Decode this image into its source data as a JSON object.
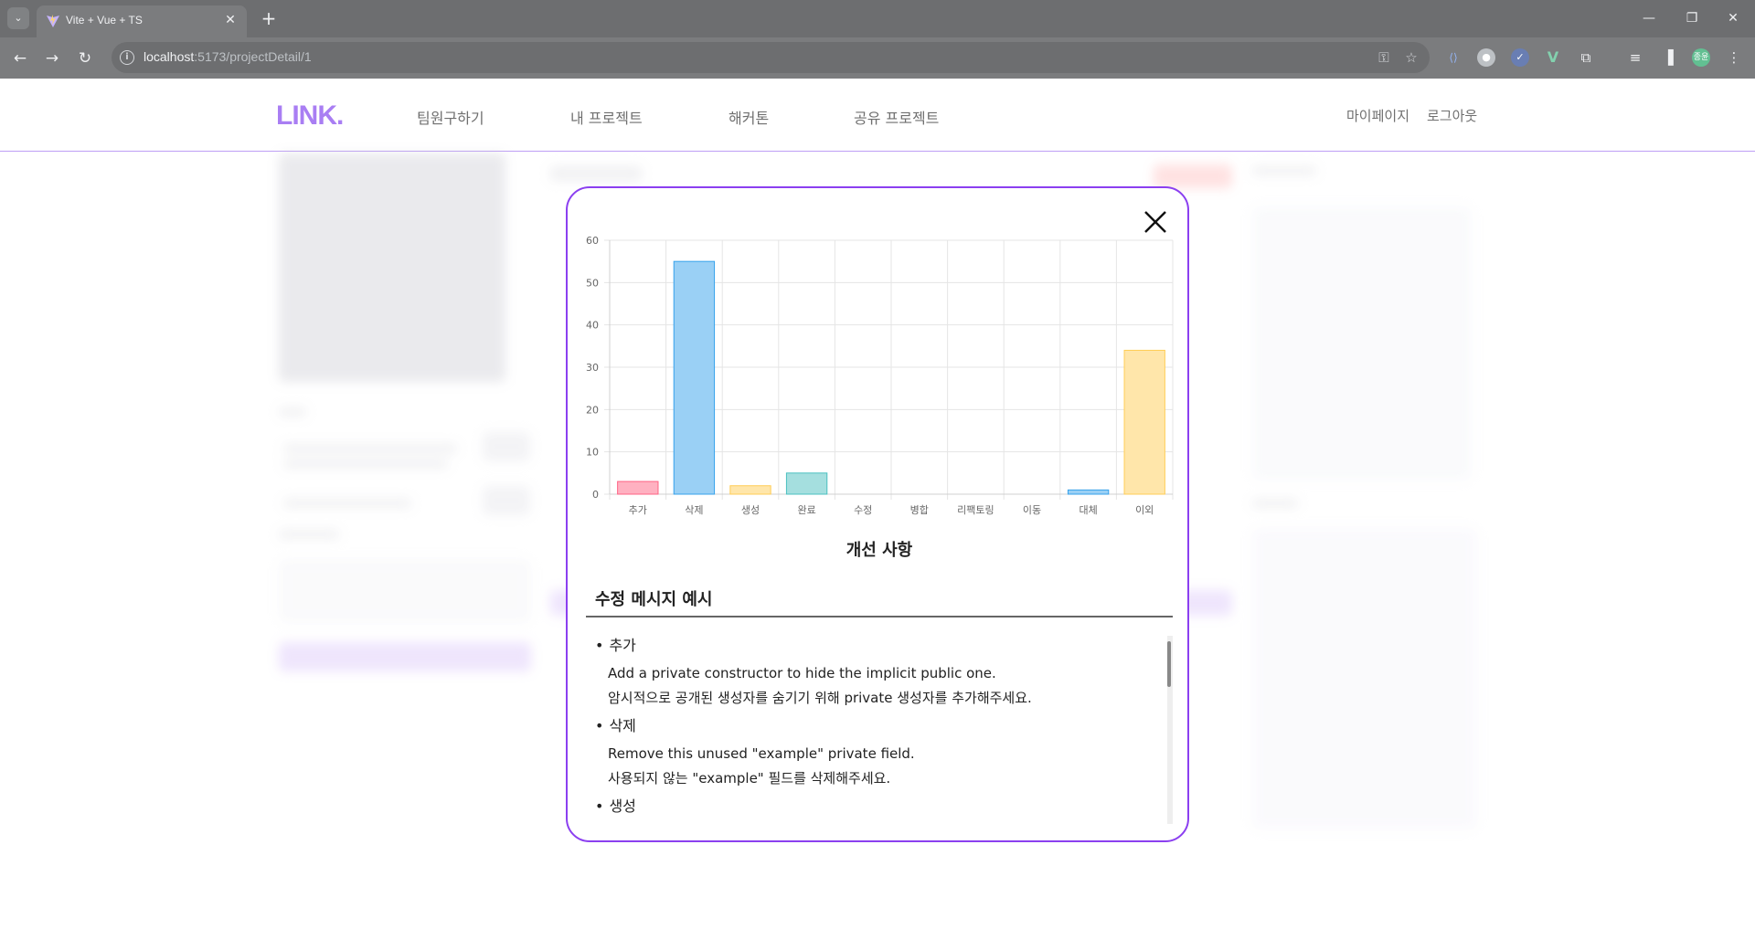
{
  "browser": {
    "tab_title": "Vite + Vue + TS",
    "url_host": "localhost",
    "url_rest": ":5173/projectDetail/1",
    "profile_initials": "종윤"
  },
  "site": {
    "logo": "LINK.",
    "nav": [
      "팀원구하기",
      "내 프로젝트",
      "해커톤",
      "공유 프로젝트"
    ],
    "mypage": "마이페이지",
    "logout": "로그아웃"
  },
  "modal": {
    "chart_title": "개선 사항",
    "section_title": "수정 메시지 예시",
    "messages": [
      {
        "category": "추가",
        "lines": [
          "Add a private constructor to hide the implicit public one.",
          "암시적으로 공개된 생성자를 숨기기 위해 private 생성자를 추가해주세요."
        ]
      },
      {
        "category": "삭제",
        "lines": [
          "Remove this unused \"example\" private field.",
          "사용되지 않는 \"example\" 필드를 삭제해주세요."
        ]
      },
      {
        "category": "생성",
        "lines": []
      }
    ]
  },
  "chart_data": {
    "type": "bar",
    "title": "개선 사항",
    "categories": [
      "추가",
      "삭제",
      "생성",
      "완료",
      "수정",
      "병합",
      "리팩토링",
      "이동",
      "대체",
      "이외"
    ],
    "values": [
      3,
      55,
      2,
      5,
      0,
      0,
      0,
      0,
      1,
      34
    ],
    "ylim": [
      0,
      60
    ],
    "yticks": [
      0,
      10,
      20,
      30,
      40,
      50,
      60
    ],
    "colors": [
      "#ffb1c1",
      "#9ad0f5",
      "#ffe6aa",
      "#a5dfdf",
      "#ccb2ff",
      "#e4e5e7",
      "#ffb1c1",
      "#ffcf9f",
      "#9ad0f5",
      "#ffe6aa"
    ],
    "borders": [
      "#ff6384",
      "#36a2eb",
      "#ffcd56",
      "#4bc0c0",
      "#9966ff",
      "#c9cbcf",
      "#ff6384",
      "#ff9f40",
      "#36a2eb",
      "#ffcd56"
    ],
    "grid": true,
    "legend": "none"
  }
}
